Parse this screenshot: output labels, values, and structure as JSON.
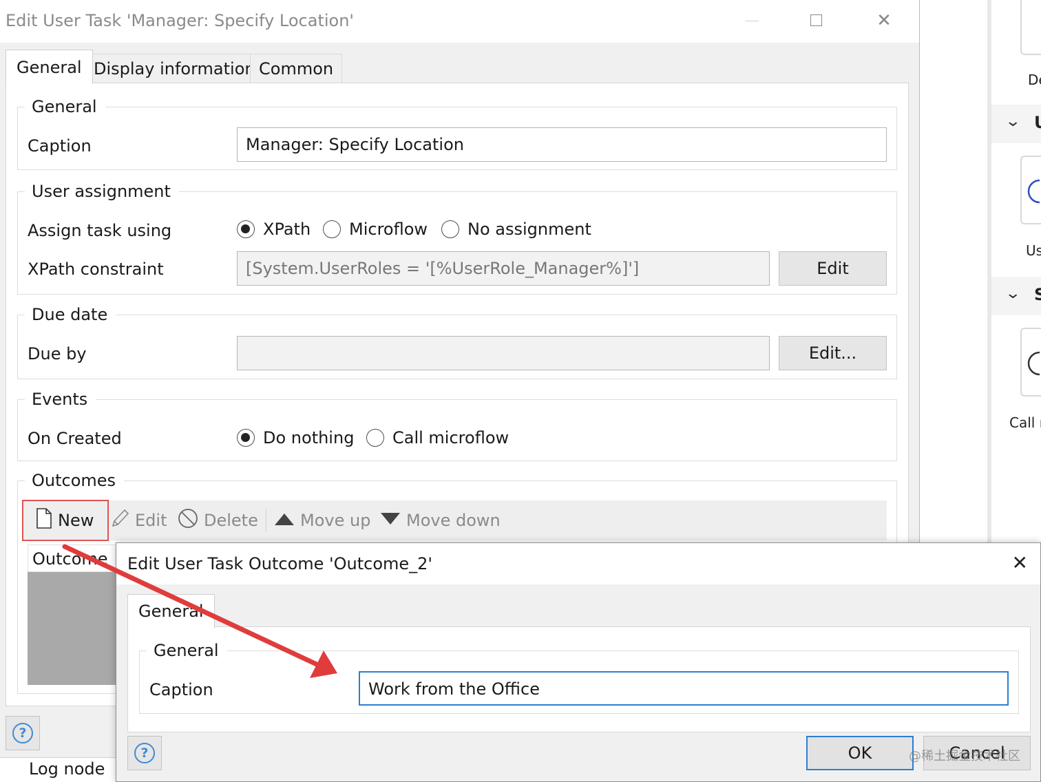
{
  "main_dialog": {
    "title": "Edit User Task 'Manager: Specify Location'",
    "tabs": [
      {
        "label": "General"
      },
      {
        "label": "Display information"
      },
      {
        "label": "Common"
      }
    ],
    "general": {
      "title": "General",
      "caption_label": "Caption",
      "caption_value": "Manager: Specify Location"
    },
    "user_assignment": {
      "title": "User assignment",
      "assign_label": "Assign task using",
      "options": [
        "XPath",
        "Microflow",
        "No assignment"
      ],
      "selected": "XPath",
      "xpath_label": "XPath constraint",
      "xpath_value": "[System.UserRoles = '[%UserRole_Manager%]']",
      "edit_label": "Edit"
    },
    "due_date": {
      "title": "Due date",
      "due_by_label": "Due by",
      "due_by_value": "",
      "edit_label": "Edit..."
    },
    "events": {
      "title": "Events",
      "on_created_label": "On Created",
      "options": [
        "Do nothing",
        "Call microflow"
      ],
      "selected": "Do nothing"
    },
    "outcomes": {
      "title": "Outcomes",
      "toolbar": {
        "new": "New",
        "edit": "Edit",
        "delete": "Delete",
        "move_up": "Move up",
        "move_down": "Move down"
      },
      "column_header": "Outcome"
    }
  },
  "side_panel": {
    "items": [
      "De",
      "U",
      "Us",
      "S",
      "Call r"
    ]
  },
  "bottom": {
    "log_node": "Log node"
  },
  "sub_dialog": {
    "title": "Edit User Task Outcome 'Outcome_2'",
    "tab_label": "General",
    "group_title": "General",
    "caption_label": "Caption",
    "caption_value": "Work from the Office",
    "ok_label": "OK",
    "cancel_label": "Cancel"
  },
  "watermark": "@稀土掘金技术社区",
  "colors": {
    "highlight": "#e05252",
    "arrow": "#e03c3c",
    "focus": "#2a7fd0"
  }
}
